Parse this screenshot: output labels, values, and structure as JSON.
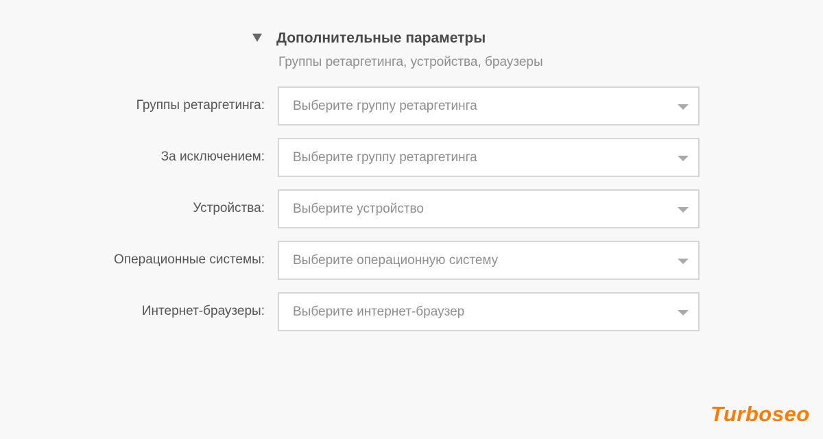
{
  "advanced": {
    "title": "Дополнительные параметры",
    "subtitle": "Группы ретаргетинга, устройства, браузеры",
    "toggle_icon": "triangle-down-icon"
  },
  "fields": [
    {
      "label": "Группы ретаргетинга:",
      "placeholder": "Выберите группу ретаргетинга"
    },
    {
      "label": "За исключением:",
      "placeholder": "Выберите группу ретаргетинга"
    },
    {
      "label": "Устройства:",
      "placeholder": "Выберите устройство"
    },
    {
      "label": "Операционные системы:",
      "placeholder": "Выберите операционную систему"
    },
    {
      "label": "Интернет-браузеры:",
      "placeholder": "Выберите интернет-браузер"
    }
  ],
  "watermark": {
    "text": "Turboseo",
    "color": "#ff7a00"
  },
  "colors": {
    "background": "#f8f8f8",
    "label_text": "#555555",
    "placeholder_text": "#8e8e8e",
    "select_border": "#d6d6d6",
    "dropdown_arrow": "#a9a9a9"
  }
}
